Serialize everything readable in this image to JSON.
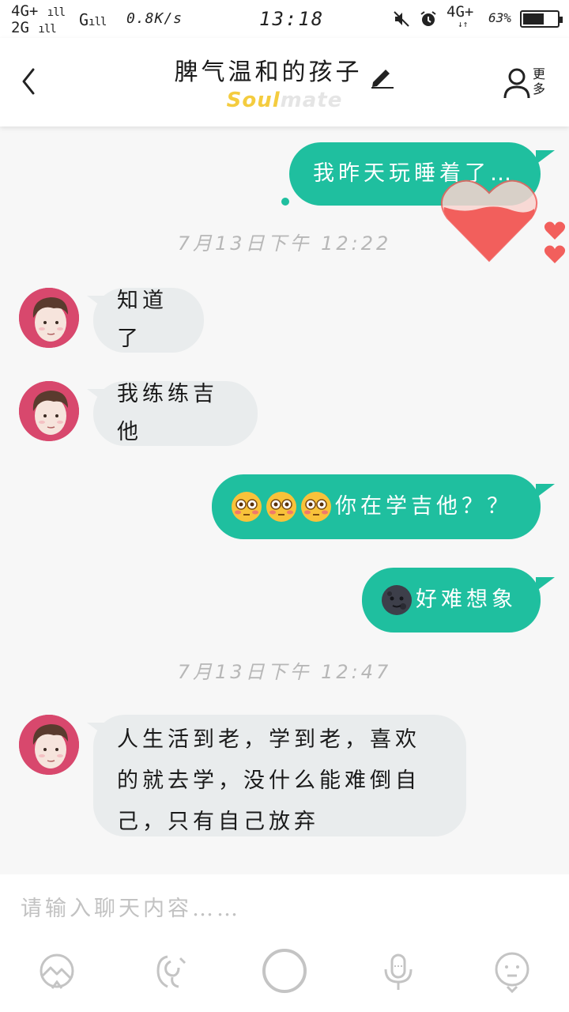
{
  "status_bar": {
    "net_top": "4G+",
    "net_bottom": "2G",
    "net_g": "G",
    "speed": "0.8K/s",
    "time": "13:18",
    "net_right": "4G+",
    "battery_text": "63%",
    "battery_level": 0.63
  },
  "header": {
    "title": "脾气温和的孩子",
    "brand_soul": "Soul",
    "brand_mate": "mate",
    "more_label": "更多"
  },
  "messages": [
    {
      "side": "out",
      "text": "我昨天玩睡着了…"
    },
    {
      "type": "timestamp",
      "text": "7月13日下午 12:22"
    },
    {
      "side": "in",
      "text": "知道了"
    },
    {
      "side": "in",
      "text": "我练练吉他"
    },
    {
      "side": "out",
      "emoji": [
        "flushed-emoji",
        "flushed-emoji",
        "flushed-emoji"
      ],
      "text": "你在学吉他？？"
    },
    {
      "side": "out",
      "emoji": [
        "new-moon-face-emoji"
      ],
      "text": "好难想象"
    },
    {
      "type": "timestamp",
      "text": "7月13日下午 12:47"
    },
    {
      "side": "in",
      "lines": [
        "人生活到老，学到老，喜欢",
        "的就去学，没什么能难倒自",
        "己，只有自己放弃"
      ]
    }
  ],
  "input": {
    "placeholder": "请输入聊天内容……"
  },
  "toolbar": {
    "icons": [
      "image-icon",
      "voice-icon",
      "record-circle-icon",
      "mic-icon",
      "face-icon"
    ]
  },
  "colors": {
    "outgoing_bubble": "#1fbf9f",
    "incoming_bubble": "#e9eced",
    "heart": "#f25f5c",
    "brand_yellow": "#f4cc3f",
    "avatar_bg": "#d8486d"
  }
}
